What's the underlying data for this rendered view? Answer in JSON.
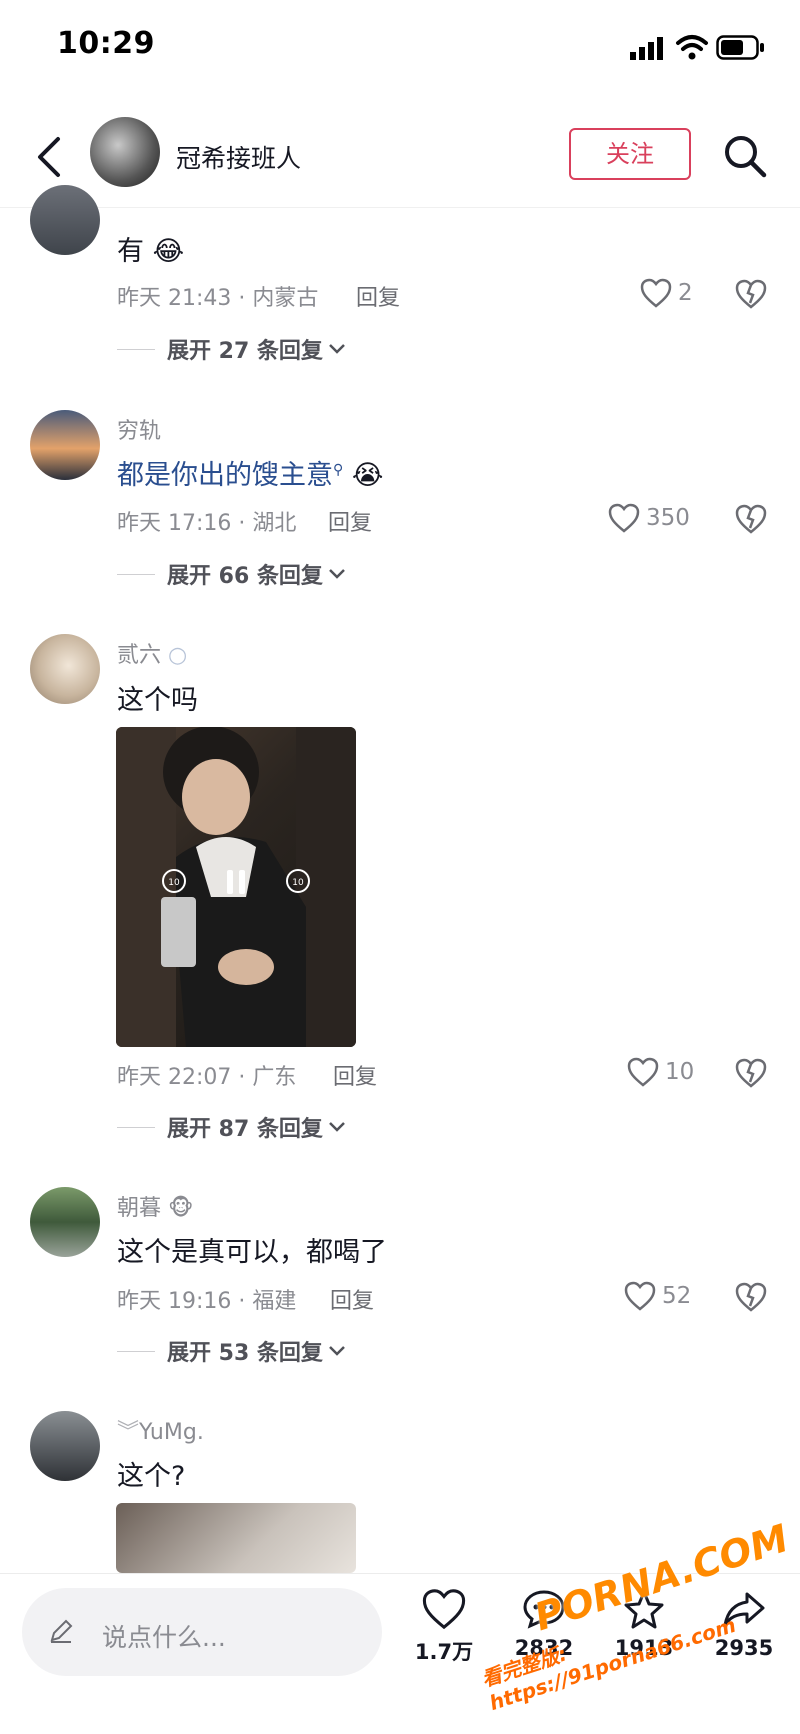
{
  "status_bar": {
    "time": "10:29"
  },
  "header": {
    "title": "冠希接班人",
    "follow_label": "关注"
  },
  "comments": [
    {
      "username": "",
      "content": "有",
      "emoji": "😂",
      "time_location": "昨天 21:43 · 内蒙古",
      "reply_label": "回复",
      "likes": "2",
      "expand_label": "展开 27 条回复"
    },
    {
      "username": "穷轨",
      "content": "都是你出的馊主意",
      "emoji": "😭",
      "time_location": "昨天 17:16 · 湖北",
      "reply_label": "回复",
      "likes": "350",
      "expand_label": "展开 66 条回复"
    },
    {
      "username": "贰六",
      "content": "这个吗",
      "time_location": "昨天 22:07 · 广东",
      "reply_label": "回复",
      "likes": "10",
      "expand_label": "展开 87 条回复"
    },
    {
      "username": "朝暮",
      "user_emoji": "🐵",
      "content": "这个是真可以，都喝了",
      "time_location": "昨天 19:16 · 福建",
      "reply_label": "回复",
      "likes": "52",
      "expand_label": "展开 53 条回复"
    },
    {
      "username": "YuMg.",
      "content": "这个?"
    }
  ],
  "bottom_bar": {
    "input_placeholder": "说点什么...",
    "like_count": "1.7万",
    "comment_count": "2832",
    "favorite_count": "1913",
    "share_count": "2935"
  },
  "watermark": {
    "line1": "PORNA.COM",
    "line2": "看完整版: https://91porna66.com"
  },
  "colors": {
    "follow_accent": "#d9405c",
    "link": "#2a4e8f",
    "watermark": "#ff8a00"
  }
}
